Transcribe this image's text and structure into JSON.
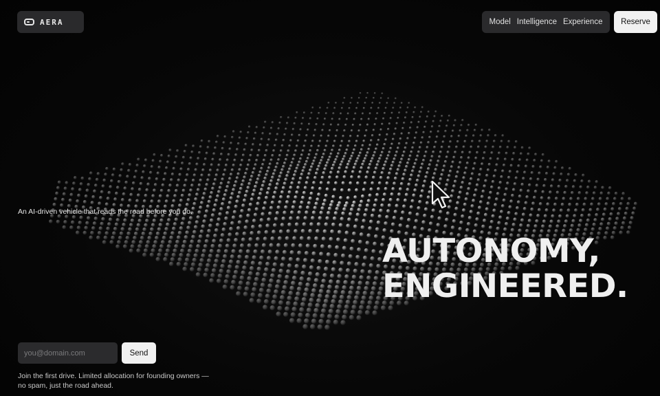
{
  "brand": {
    "name": "AERA",
    "logo_icon": "car-window-icon"
  },
  "nav": {
    "items": [
      {
        "label": "Model"
      },
      {
        "label": "Intelligence"
      },
      {
        "label": "Experience"
      }
    ],
    "reserve_label": "Reserve"
  },
  "hero": {
    "tagline": "An AI-driven vehicle that reads the road before you do.",
    "headline_line1": "AUTONOMY,",
    "headline_line2": "ENGINEERED.",
    "background_icon": "particle-wave-mesh"
  },
  "signup": {
    "email_placeholder": "you@domain.com",
    "email_value": "",
    "send_label": "Send",
    "note": "Join the first drive. Limited allocation for founding owners — no spam, just the road ahead."
  },
  "colors": {
    "background": "#050505",
    "panel": "#2a2a2c",
    "button_light": "#f1f1f1",
    "text": "#ececec"
  }
}
